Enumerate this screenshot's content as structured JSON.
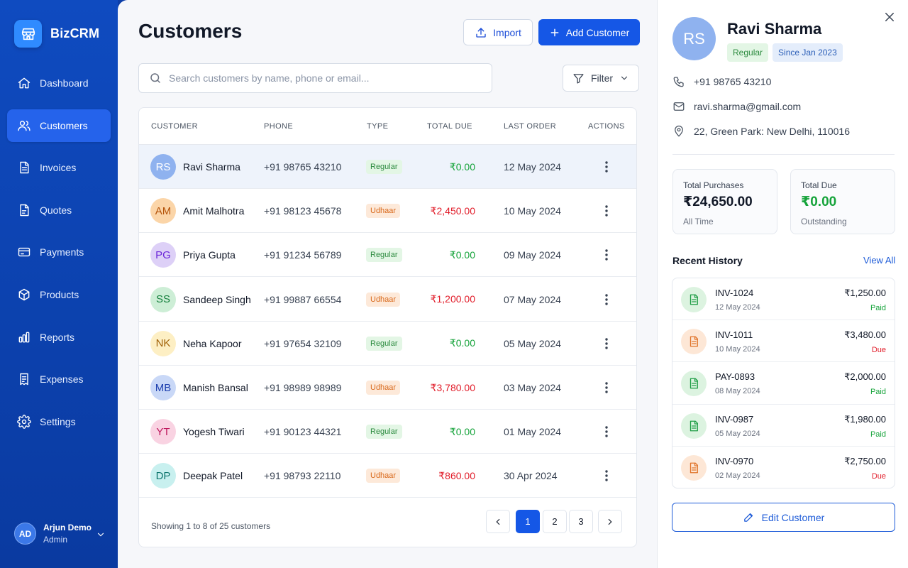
{
  "brand": {
    "name": "BizCRM"
  },
  "nav": [
    {
      "label": "Dashboard",
      "icon": "home-icon",
      "active": false
    },
    {
      "label": "Customers",
      "icon": "users-icon",
      "active": true
    },
    {
      "label": "Invoices",
      "icon": "invoice-icon",
      "active": false
    },
    {
      "label": "Quotes",
      "icon": "quote-icon",
      "active": false
    },
    {
      "label": "Payments",
      "icon": "card-icon",
      "active": false
    },
    {
      "label": "Products",
      "icon": "box-icon",
      "active": false
    },
    {
      "label": "Reports",
      "icon": "chart-icon",
      "active": false
    },
    {
      "label": "Expenses",
      "icon": "receipt-icon",
      "active": false
    },
    {
      "label": "Settings",
      "icon": "gear-icon",
      "active": false
    }
  ],
  "user": {
    "initials": "AD",
    "name": "Arjun Demo",
    "role": "Admin"
  },
  "main": {
    "title": "Customers",
    "import_label": "Import",
    "add_label": "Add Customer",
    "search_placeholder": "Search customers by name, phone or email...",
    "filter_label": "Filter"
  },
  "table": {
    "headers": [
      "CUSTOMER",
      "PHONE",
      "TYPE",
      "TOTAL DUE",
      "LAST ORDER",
      "ACTIONS"
    ],
    "rows": [
      {
        "initials": "RS",
        "name": "Ravi Sharma",
        "phone": "+91 98765 43210",
        "type": "Regular",
        "due": "₹0.00",
        "last_order": "12 May 2024",
        "avatar_bg": "#8fb2ef",
        "avatar_fg": "#ffffff",
        "selected": true
      },
      {
        "initials": "AM",
        "name": "Amit Malhotra",
        "phone": "+91 98123 45678",
        "type": "Udhaar",
        "due": "₹2,450.00",
        "last_order": "10 May 2024",
        "avatar_bg": "#fbd5a8",
        "avatar_fg": "#b45309",
        "selected": false
      },
      {
        "initials": "PG",
        "name": "Priya Gupta",
        "phone": "+91 91234 56789",
        "type": "Regular",
        "due": "₹0.00",
        "last_order": "09 May 2024",
        "avatar_bg": "#ddd0f7",
        "avatar_fg": "#6d28d9",
        "selected": false
      },
      {
        "initials": "SS",
        "name": "Sandeep Singh",
        "phone": "+91 99887 66554",
        "type": "Udhaar",
        "due": "₹1,200.00",
        "last_order": "07 May 2024",
        "avatar_bg": "#cdeed6",
        "avatar_fg": "#15803d",
        "selected": false
      },
      {
        "initials": "NK",
        "name": "Neha Kapoor",
        "phone": "+91 97654 32109",
        "type": "Regular",
        "due": "₹0.00",
        "last_order": "05 May 2024",
        "avatar_bg": "#fdefc4",
        "avatar_fg": "#a16207",
        "selected": false
      },
      {
        "initials": "MB",
        "name": "Manish Bansal",
        "phone": "+91 98989 98989",
        "type": "Udhaar",
        "due": "₹3,780.00",
        "last_order": "03 May 2024",
        "avatar_bg": "#c9d8f7",
        "avatar_fg": "#1e40af",
        "selected": false
      },
      {
        "initials": "YT",
        "name": "Yogesh Tiwari",
        "phone": "+91 90123 44321",
        "type": "Regular",
        "due": "₹0.00",
        "last_order": "01 May 2024",
        "avatar_bg": "#f9d3e2",
        "avatar_fg": "#be185d",
        "selected": false
      },
      {
        "initials": "DP",
        "name": "Deepak Patel",
        "phone": "+91 98793 22110",
        "type": "Udhaar",
        "due": "₹860.00",
        "last_order": "30 Apr 2024",
        "avatar_bg": "#c8f0ef",
        "avatar_fg": "#0f766e",
        "selected": false
      }
    ],
    "showing_text": "Showing 1 to 8 of 25 customers",
    "pages": [
      "1",
      "2",
      "3"
    ],
    "current_page": "1"
  },
  "panel": {
    "initials": "RS",
    "name": "Ravi Sharma",
    "type_badge": "Regular",
    "since_badge": "Since Jan 2023",
    "phone": "+91 98765 43210",
    "email": "ravi.sharma@gmail.com",
    "address": "22, Green Park: New Delhi, 110016",
    "total_purchases": {
      "label": "Total Purchases",
      "value": "₹24,650.00",
      "sub": "All Time"
    },
    "total_due": {
      "label": "Total Due",
      "value": "₹0.00",
      "sub": "Outstanding"
    },
    "recent_title": "Recent History",
    "view_all": "View All",
    "history": [
      {
        "id": "INV-1024",
        "date": "12 May 2024",
        "amount": "₹1,250.00",
        "status": "Paid"
      },
      {
        "id": "INV-1011",
        "date": "10 May 2024",
        "amount": "₹3,480.00",
        "status": "Due"
      },
      {
        "id": "PAY-0893",
        "date": "08 May 2024",
        "amount": "₹2,000.00",
        "status": "Paid"
      },
      {
        "id": "INV-0987",
        "date": "05 May 2024",
        "amount": "₹1,980.00",
        "status": "Paid"
      },
      {
        "id": "INV-0970",
        "date": "02 May 2024",
        "amount": "₹2,750.00",
        "status": "Due"
      }
    ],
    "edit_label": "Edit Customer"
  },
  "colors": {
    "accent": "#1557e6",
    "sidebar": "#0f4bc0",
    "paid": "#15a33a",
    "due": "#e11d2a"
  }
}
